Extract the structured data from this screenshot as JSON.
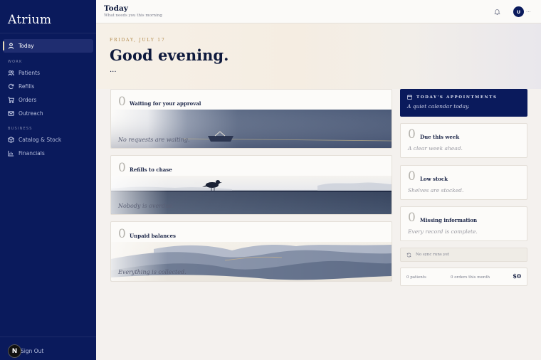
{
  "sidebar": {
    "brand": "Atrium",
    "items": [
      {
        "label": "Today",
        "icon": "user-icon"
      },
      {
        "label": "Patients",
        "icon": "users-icon"
      },
      {
        "label": "Refills",
        "icon": "refresh-icon"
      },
      {
        "label": "Orders",
        "icon": "cart-icon"
      },
      {
        "label": "Outreach",
        "icon": "mail-icon"
      },
      {
        "label": "Catalog & Stock",
        "icon": "box-icon"
      },
      {
        "label": "Financials",
        "icon": "chart-icon"
      }
    ],
    "sections": {
      "work": "WORK",
      "business": "BUSINESS"
    },
    "signout": "Sign Out",
    "badge": "N"
  },
  "topbar": {
    "title": "Today",
    "subtitle": "What needs you this morning",
    "avatar": "U",
    "avatar_more": "..."
  },
  "hero": {
    "date": "FRIDAY, JULY 17",
    "greeting": "Good evening.",
    "dots": "..."
  },
  "cards": [
    {
      "count": "0",
      "title": "Waiting for your approval",
      "caption": "No requests are waiting."
    },
    {
      "count": "0",
      "title": "Refills to chase",
      "caption": "Nobody is overdue."
    },
    {
      "count": "0",
      "title": "Unpaid balances",
      "caption": "Everything is collected."
    }
  ],
  "appointments": {
    "title": "TODAY'S APPOINTMENTS",
    "subtitle": "A quiet calendar today."
  },
  "side_cards": [
    {
      "count": "0",
      "title": "Due this week",
      "subtitle": "A clear week ahead."
    },
    {
      "count": "0",
      "title": "Low stock",
      "subtitle": "Shelves are stocked."
    },
    {
      "count": "0",
      "title": "Missing information",
      "subtitle": "Every record is complete."
    }
  ],
  "sync": {
    "label": "No sync runs yet"
  },
  "stats": {
    "patients": "0 patients",
    "orders": "0 orders this month",
    "total": "$0"
  },
  "colors": {
    "sidebar": "#0a1a5c",
    "accent_gold": "#b28a4a",
    "background": "#f4f1ee"
  }
}
